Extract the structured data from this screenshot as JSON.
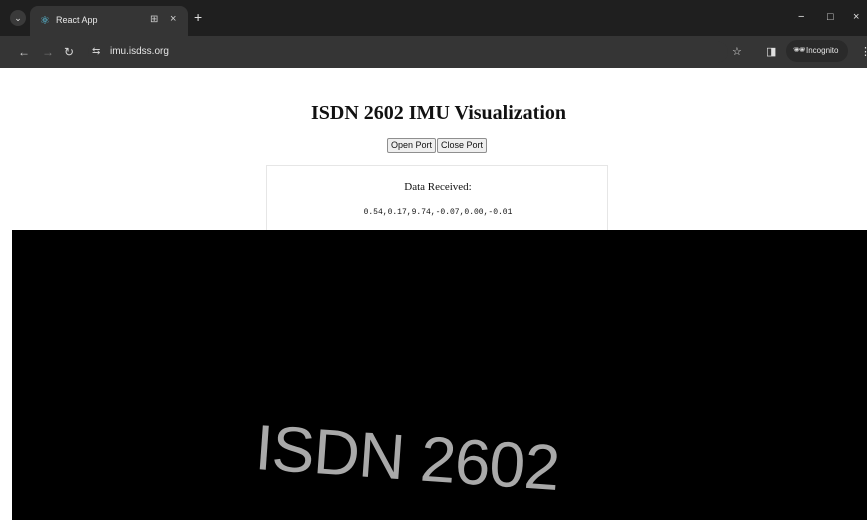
{
  "browser": {
    "tab": {
      "title": "React App",
      "favicon": "react-icon",
      "group_icon": "⊞",
      "close": "×"
    },
    "new_tab": "+",
    "url": "imu.isdss.org",
    "incognito_label": "Incognito",
    "window_controls": {
      "minimize": "−",
      "maximize": "□",
      "close": "×"
    },
    "colors": {
      "tab_bar": "#1f1f1f",
      "toolbar": "#353535"
    }
  },
  "page": {
    "title": "ISDN 2602 IMU Visualization",
    "open_port_label": "Open Port",
    "close_port_label": "Close Port",
    "data_received_label": "Data Received:",
    "data_values": "0.54,0.17,9.74,-0.07,0.00,-0.01",
    "canvas_text": "ISDN 2602",
    "colors": {
      "canvas_bg": "#000000",
      "canvas_text": "#a9a9a9"
    }
  }
}
